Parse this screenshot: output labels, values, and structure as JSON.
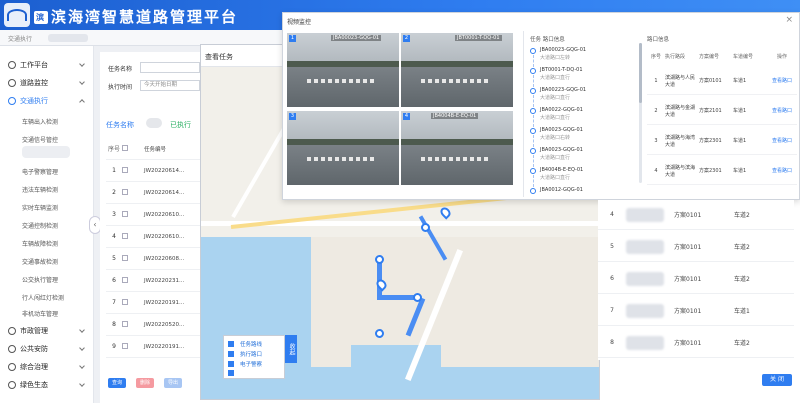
{
  "app": {
    "title": "滨海湾智慧道路管理平台",
    "badge": "滨"
  },
  "breadcrumb": "交通执行",
  "sidebar": {
    "items": [
      {
        "label": "工作平台"
      },
      {
        "label": "道路监控"
      },
      {
        "label": "交通执行"
      }
    ],
    "sub_items": [
      {
        "label": "车辆出入检测"
      },
      {
        "label": "交通信号管控"
      },
      {
        "label": "电子警察管理"
      },
      {
        "label": "违法车辆检测"
      },
      {
        "label": "实时车辆监测"
      },
      {
        "label": "交通控制检测"
      },
      {
        "label": "车辆故障检测"
      },
      {
        "label": "交通事故检测"
      },
      {
        "label": "公交执行管理"
      },
      {
        "label": "行人闯红灯检测"
      },
      {
        "label": "非机动车管理"
      }
    ],
    "bottom_items": [
      {
        "label": "市政管理"
      },
      {
        "label": "公共安防"
      },
      {
        "label": "综合治理"
      },
      {
        "label": "绿色生态"
      }
    ]
  },
  "filters": {
    "task_name_label": "任务名称",
    "exec_time_label": "执行时间",
    "exec_time_value": "今天开始日期"
  },
  "task_list": {
    "header": "任务名称",
    "status": "已执行",
    "col_no": "序号",
    "col_code": "任务编号",
    "rows": [
      {
        "no": "1",
        "code": "JW20220614..."
      },
      {
        "no": "2",
        "code": "JW20220614..."
      },
      {
        "no": "3",
        "code": "JW20220610..."
      },
      {
        "no": "4",
        "code": "JW20220610..."
      },
      {
        "no": "5",
        "code": "JW20220608..."
      },
      {
        "no": "6",
        "code": "JW20220231..."
      },
      {
        "no": "7",
        "code": "JW20220191..."
      },
      {
        "no": "8",
        "code": "JW20220520..."
      },
      {
        "no": "9",
        "code": "JW20220191..."
      }
    ],
    "buttons": [
      "查询",
      "删除",
      "导出"
    ]
  },
  "map": {
    "title": "查看任务",
    "fold_label": "收起",
    "legend": [
      {
        "label": "任务路线"
      },
      {
        "label": "执行路口"
      },
      {
        "label": "电子警察"
      },
      {
        "label": ""
      }
    ]
  },
  "video_popup": {
    "title": "视频监控",
    "cameras": [
      {
        "no": "1",
        "label": "JBA00023-GQG-01"
      },
      {
        "no": "2",
        "label": "JBT0001-T-DQ-01"
      },
      {
        "no": "3",
        "label": ""
      },
      {
        "no": "4",
        "label": "JB4004B-E-EQ-01"
      }
    ],
    "timeline_header": "任务 路口信息",
    "timeline": [
      {
        "t1": "JBA00023-GQG-01",
        "t2": "大道路口左转"
      },
      {
        "t1": "JBT0001-T-DQ-01",
        "t2": "大道路口直行"
      },
      {
        "t1": "JBA00223-GQG-01",
        "t2": "大道路口直行"
      },
      {
        "t1": "JBA0022-GQG-01",
        "t2": "大道路口直行"
      },
      {
        "t1": "JBA0023-GQG-01",
        "t2": "大道路口右转"
      },
      {
        "t1": "JBA0023-GQG-01",
        "t2": "大道路口直行"
      },
      {
        "t1": "JB4004B-E-EQ-01",
        "t2": "大道路口直行"
      },
      {
        "t1": "JBA0012-GQG-01",
        "t2": "大道路口直行"
      }
    ],
    "stop_table": {
      "header": "路口信息",
      "cols": [
        "序号",
        "执行路段",
        "方案编号",
        "车道编号",
        "操作"
      ],
      "rows": [
        {
          "no": "1",
          "seg": "滨湖路与人民大道",
          "plan": "方案0101",
          "lane": "车道1",
          "op": "查看路口"
        },
        {
          "no": "2",
          "seg": "滨湖路与金湖大道",
          "plan": "方案2101",
          "lane": "车道1",
          "op": "查看路口"
        },
        {
          "no": "3",
          "seg": "滨湖路与海湾大道",
          "plan": "方案2301",
          "lane": "车道1",
          "op": "查看路口"
        },
        {
          "no": "4",
          "seg": "滨湖路与滨海大道",
          "plan": "方案2301",
          "lane": "车道1",
          "op": "查看路口"
        }
      ]
    }
  },
  "right_table": {
    "rows": [
      {
        "no": "4",
        "code": "方案0101",
        "lane": "车道2"
      },
      {
        "no": "5",
        "code": "方案0101",
        "lane": "车道2"
      },
      {
        "no": "6",
        "code": "方案0101",
        "lane": "车道2"
      },
      {
        "no": "7",
        "code": "方案0101",
        "lane": "车道1"
      },
      {
        "no": "8",
        "code": "方案0101",
        "lane": "车道2"
      }
    ],
    "confirm": "关 闭"
  }
}
